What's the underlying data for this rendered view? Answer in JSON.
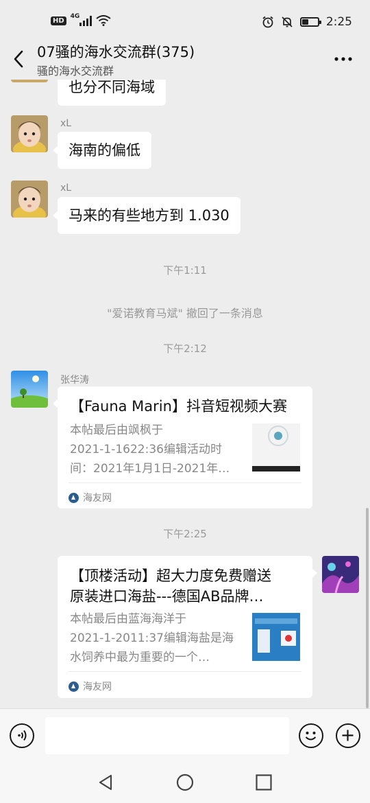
{
  "status_bar": {
    "hd_label": "HD",
    "network_label": "4G",
    "time": "2:25",
    "battery_level": 0.4,
    "icons": [
      "signal-icon",
      "wifi-icon",
      "alarm-icon",
      "mute-icon",
      "battery-icon"
    ]
  },
  "header": {
    "title": "07骚的海水交流群(375)",
    "subtitle": "骚的海水交流群",
    "back_icon": "back-arrow-icon",
    "more_icon": "more-dots-icon"
  },
  "messages": {
    "m0": {
      "text": "也分不同海域"
    },
    "m1": {
      "sender": "xL",
      "text": "海南的偏低"
    },
    "m2": {
      "sender": "xL",
      "text": "马来的有些地方到 1.030"
    },
    "t1": "下午1:11",
    "recall": "\"爱诺教育马斌\" 撤回了一条消息",
    "t2": "下午2:12",
    "m3": {
      "sender": "张华涛",
      "title": "【Fauna Marin】抖音短视频大赛",
      "desc_lines": [
        "本帖最后由飒枫于",
        "2021-1-1622:36编辑活动时",
        "间：2021年1月1日-2021年…"
      ],
      "source": "海友网"
    },
    "t3": "下午2:25",
    "m4": {
      "title_lines": [
        "【顶楼活动】超大力度免费赠送",
        "原装进口海盐---德国AB品牌…"
      ],
      "desc_lines": [
        "本帖最后由蓝海海洋于",
        "2021-1-2011:37编辑海盐是海",
        "水饲养中最为重要的一个…"
      ],
      "source": "海友网"
    }
  },
  "input_bar": {
    "voice_icon": "voice-icon",
    "placeholder": "",
    "emoji_icon": "emoji-icon",
    "plus_icon": "plus-icon"
  },
  "nav_bar": {
    "icons": [
      "nav-back-icon",
      "nav-home-icon",
      "nav-recent-icon"
    ]
  }
}
